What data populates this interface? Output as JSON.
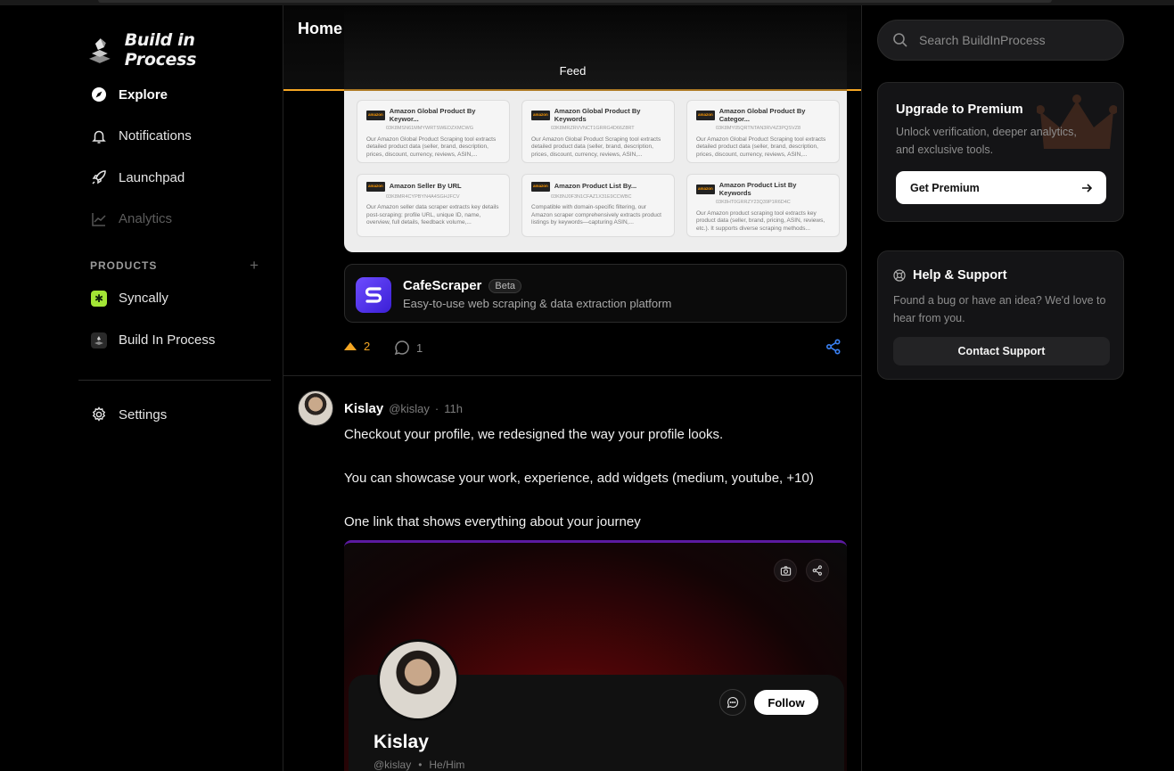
{
  "app": {
    "name": "Build in Process"
  },
  "nav": {
    "items": [
      {
        "label": "Explore",
        "icon": "compass-icon",
        "active": true
      },
      {
        "label": "Notifications",
        "icon": "bell-icon"
      },
      {
        "label": "Launchpad",
        "icon": "rocket-icon"
      },
      {
        "label": "Analytics",
        "icon": "chart-icon",
        "disabled": true
      }
    ],
    "products_heading": "PRODUCTS",
    "products_add": "+",
    "products": [
      {
        "label": "Syncally",
        "icon": "syncally-logo-icon"
      },
      {
        "label": "Build In Process",
        "icon": "bip-logo-icon"
      }
    ],
    "settings_label": "Settings"
  },
  "header": {
    "title": "Home",
    "tab": "Feed",
    "accent": "#f5a623"
  },
  "post1": {
    "screenshot_cards": [
      {
        "title": "Amazon Global Product By Keywor...",
        "id": "03K8MSN61MMYWRTSWEDZXMCWG",
        "desc": "Our Amazon Global Product Scraping tool extracts detailed product data (seller, brand, description, prices, discount, currency, reviews, ASIN,..."
      },
      {
        "title": "Amazon Global Product By Keywords",
        "id": "03K8MRZRVVNCT1GRRG4D66Z8RT",
        "desc": "Our Amazon Global Product Scraping tool extracts detailed product data (seller, brand, description, prices, discount, currency, reviews, ASIN,..."
      },
      {
        "title": "Amazon Global Product By Categor...",
        "id": "03K8MY05QRTNTAN3RV4Z3PQSVZ8",
        "desc": "Our Amazon Global Product Scraping tool extracts detailed product data (seller, brand, description, prices, discount, currency, reviews, ASIN,..."
      },
      {
        "title": "Amazon Seller By URL",
        "id": "03K8MR4CYPBYN4A4SGHJFCV",
        "desc": "Our Amazon seller data scraper extracts key details post-scraping: profile URL, unique ID, name, overview, full details, feedback volume,..."
      },
      {
        "title": "Amazon Product List By...",
        "id": "03K8NJ0F3N1CFAZ1X31E9CCWBC",
        "desc": "Compatible with domain-specific filtering, our Amazon scraper comprehensively extracts product listings by keywords—capturing ASIN,..."
      },
      {
        "title": "Amazon Product List By Keywords",
        "id": "03K8HT0GRRZY23Q39P1R6D4C",
        "desc": "Our Amazon product scraping tool extracts key product data (seller, brand, pricing, ASIN, reviews, etc.). It supports diverse scraping methods..."
      }
    ],
    "product": {
      "name": "CafeScraper",
      "badge": "Beta",
      "description": "Easy-to-use web scraping & data extraction platform"
    },
    "upvotes": "2",
    "comments": "1"
  },
  "post2": {
    "author": "Kislay",
    "handle": "@kislay",
    "separator": "·",
    "time": "11h",
    "lines": [
      "Checkout your profile, we redesigned the way your profile looks.",
      "You can showcase your work, experience, add widgets (medium, youtube, +10)",
      "One link that shows everything about your journey"
    ],
    "preview": {
      "name": "Kislay",
      "handle": "@kislay",
      "dot": "•",
      "pronouns": "He/Him",
      "follow_label": "Follow"
    }
  },
  "search": {
    "placeholder": "Search BuildInProcess"
  },
  "premium": {
    "title": "Upgrade to Premium",
    "description": "Unlock verification, deeper analytics, and exclusive tools.",
    "button": "Get Premium"
  },
  "help": {
    "title": "Help & Support",
    "description": "Found a bug or have an idea? We'd love to hear from you.",
    "button": "Contact Support"
  }
}
